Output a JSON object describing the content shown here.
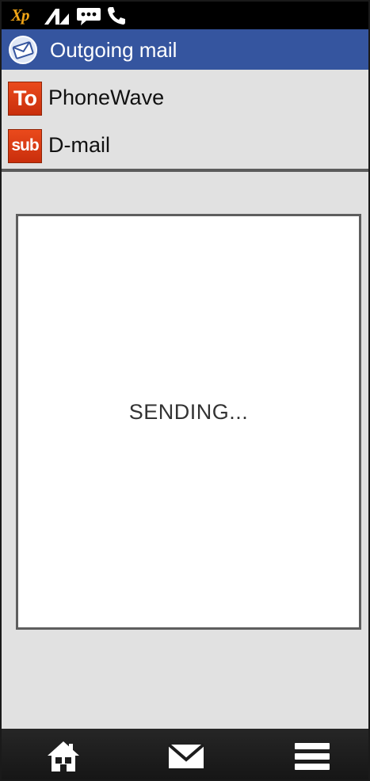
{
  "status_bar": {
    "carrier_logo": "Xp",
    "icons": [
      "signal-icon",
      "chat-icon",
      "phone-icon"
    ]
  },
  "title_bar": {
    "title": "Outgoing mail",
    "icon": "envelope-icon"
  },
  "recipients": {
    "to": {
      "tag": "To",
      "label": "PhoneWave"
    },
    "subject": {
      "tag": "sub",
      "label": "D-mail"
    }
  },
  "status": {
    "message": "SENDING..."
  },
  "nav": {
    "items": [
      "home-icon",
      "mail-icon",
      "menu-icon"
    ]
  },
  "colors": {
    "title_bar": "#35559f",
    "tag": "#d93a12",
    "background": "#e1e1e1",
    "carrier_logo": "#f2a516"
  }
}
